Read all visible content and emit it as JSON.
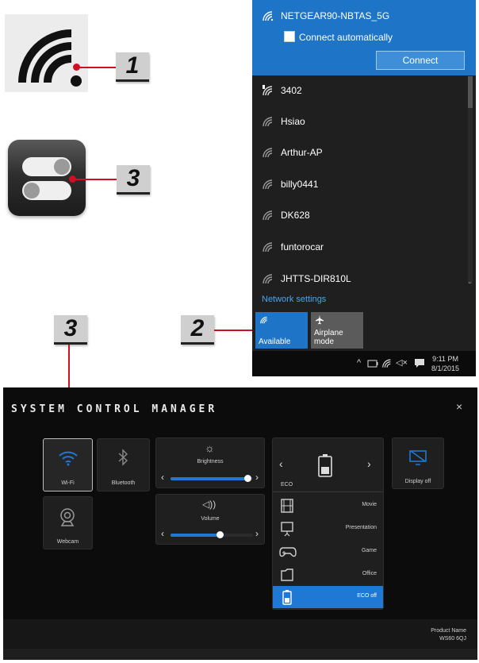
{
  "callouts": {
    "c1": "1",
    "c2": "2",
    "c3a": "3",
    "c3b": "3"
  },
  "icons": {
    "wifi_status": "wifi-icon",
    "toggle_settings": "toggle-switches-icon"
  },
  "network_flyout": {
    "connected_network": {
      "name": "NETGEAR90-NBTAS_5G",
      "auto_connect_label": "Connect automatically",
      "auto_connect_checked": false,
      "connect_button": "Connect"
    },
    "networks": [
      {
        "name": "3402",
        "secured": true
      },
      {
        "name": "Hsiao",
        "secured": false
      },
      {
        "name": "Arthur-AP",
        "secured": false
      },
      {
        "name": "billy0441",
        "secured": false
      },
      {
        "name": "DK628",
        "secured": false
      },
      {
        "name": "funtorocar",
        "secured": false
      },
      {
        "name": "JHTTS-DIR810L",
        "secured": false
      }
    ],
    "network_settings_link": "Network settings",
    "tiles": [
      {
        "label": "Available",
        "icon": "wifi-icon",
        "active": true
      },
      {
        "label": "Airplane mode",
        "icon": "airplane-icon",
        "active": false
      }
    ],
    "taskbar": {
      "time": "9:11 PM",
      "date": "8/1/2015"
    }
  },
  "scm": {
    "title": "SYSTEM CONTROL MANAGER",
    "close": "×",
    "tiles": {
      "wifi": "Wi-Fi",
      "bluetooth": "Bluetooth",
      "webcam": "Webcam",
      "display_off": "Display off"
    },
    "brightness": {
      "label": "Brightness",
      "level": 0.93
    },
    "volume": {
      "label": "Volume",
      "level": 0.6
    },
    "power": {
      "current": "ECO",
      "modes": [
        "Movie",
        "Presentation",
        "Game",
        "Office",
        "ECO off"
      ],
      "selected": "ECO off"
    },
    "product": {
      "label": "Product Name",
      "model": "WS60 6QJ"
    }
  },
  "colors": {
    "accent": "#1e78d4",
    "callout_red": "#d10f22",
    "flyout_blue": "#1e74c6"
  }
}
